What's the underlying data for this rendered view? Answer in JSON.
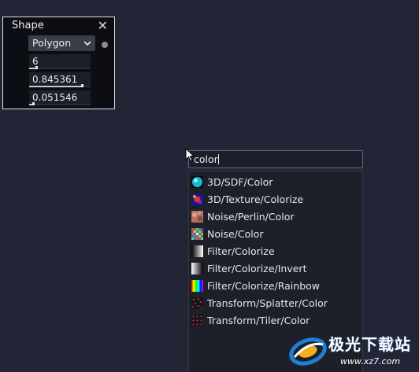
{
  "shape_node": {
    "title": "Shape",
    "close_glyph": "✕",
    "shape_type": "Polygon",
    "params": [
      {
        "value": "6",
        "slider_fraction": 0.12
      },
      {
        "value": "0.845361",
        "slider_fraction": 0.85
      },
      {
        "value": "0.051546",
        "slider_fraction": 0.05
      }
    ]
  },
  "search": {
    "query": "color"
  },
  "results": [
    {
      "label": "3D/SDF/Color",
      "icon": "sdf-sphere-icon"
    },
    {
      "label": "3D/Texture/Colorize",
      "icon": "texture-colorize-icon"
    },
    {
      "label": "Noise/Perlin/Color",
      "icon": "perlin-noise-icon"
    },
    {
      "label": "Noise/Color",
      "icon": "color-noise-icon"
    },
    {
      "label": "Filter/Colorize",
      "icon": "gradient-icon"
    },
    {
      "label": "Filter/Colorize/Invert",
      "icon": "gradient-invert-icon"
    },
    {
      "label": "Filter/Colorize/Rainbow",
      "icon": "rainbow-icon"
    },
    {
      "label": "Transform/Splatter/Color",
      "icon": "splatter-icon"
    },
    {
      "label": "Transform/Tiler/Color",
      "icon": "tiler-icon"
    }
  ],
  "watermark": {
    "text": "极光下载站",
    "url": "www.xz7.com"
  }
}
